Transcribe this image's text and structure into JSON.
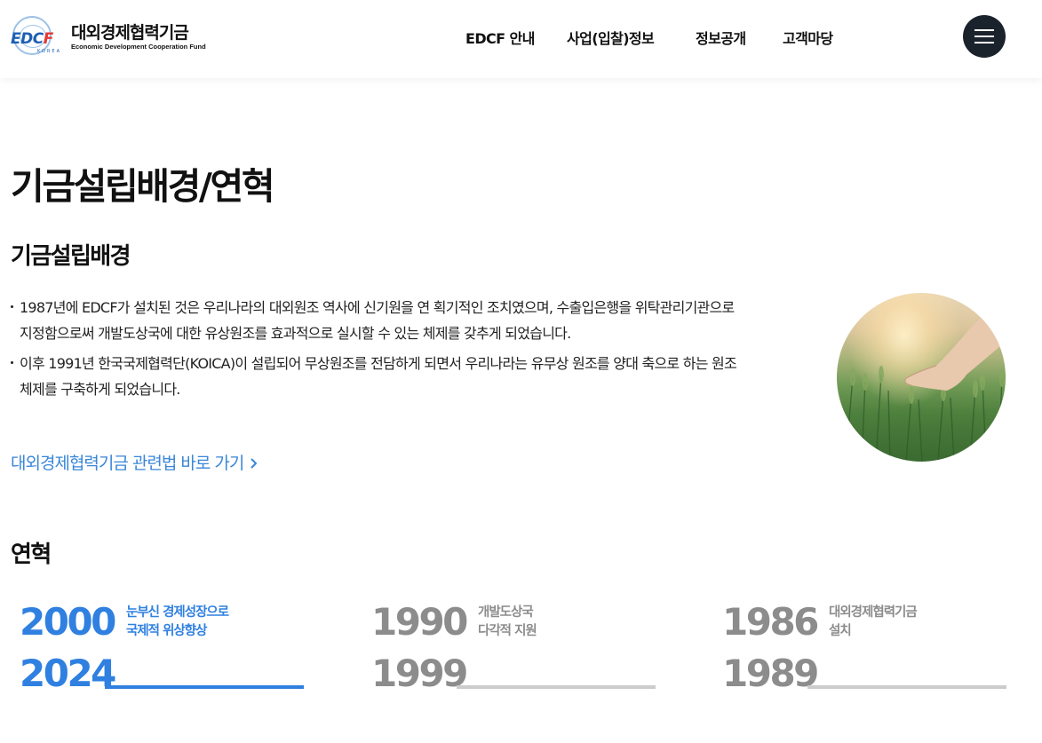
{
  "header": {
    "logo": {
      "mark_text": "EDCF",
      "mark_sub": "KOREA",
      "name": "대외경제협력기금",
      "subtitle": "Economic Development Cooperation Fund"
    },
    "nav": [
      "EDCF 안내",
      "사업(입찰)정보",
      "정보공개",
      "고객마당"
    ],
    "menu_icon": "hamburger-menu-icon"
  },
  "page": {
    "title": "기금설립배경/연혁",
    "background_section": {
      "title": "기금설립배경",
      "bullets": [
        "1987년에 EDCF가 설치된 것은 우리나라의 대외원조 역사에 신기원을 연 획기적인 조치였으며, 수출입은행을 위탁관리기관으로 지정함으로써 개발도상국에 대한 유상원조를 효과적으로 실시할 수 있는 체제를 갖추게 되었습니다.",
        "이후 1991년 한국국제협력단(KOICA)이 설립되어 무상원조를 전담하게 되면서 우리나라는 유무상 원조를 양대 축으로 하는 원조체제를 구축하게 되었습니다."
      ],
      "link_label": "대외경제협력기금 관련법 바로 가기",
      "link_icon": "chevron-right-icon",
      "image_desc_icon": "hand-over-wheat-field-image"
    },
    "history_section": {
      "title": "연혁",
      "items": [
        {
          "start": "2000",
          "end": "2024",
          "line1": "눈부신 경제성장으로",
          "line2": "국제적 위상향상",
          "active": true
        },
        {
          "start": "1990",
          "end": "1999",
          "line1": "개발도상국",
          "line2": "다각적 지원",
          "active": false
        },
        {
          "start": "1986",
          "end": "1989",
          "line1": "대외경제협력기금",
          "line2": "설치",
          "active": false
        }
      ]
    }
  },
  "colors": {
    "accent_blue": "#3a86d8",
    "timeline_active": "#2f80e0",
    "timeline_inactive": "#8c8c8c",
    "timeline_bar_inactive": "#cccccc",
    "menu_button": "#1a222c"
  }
}
